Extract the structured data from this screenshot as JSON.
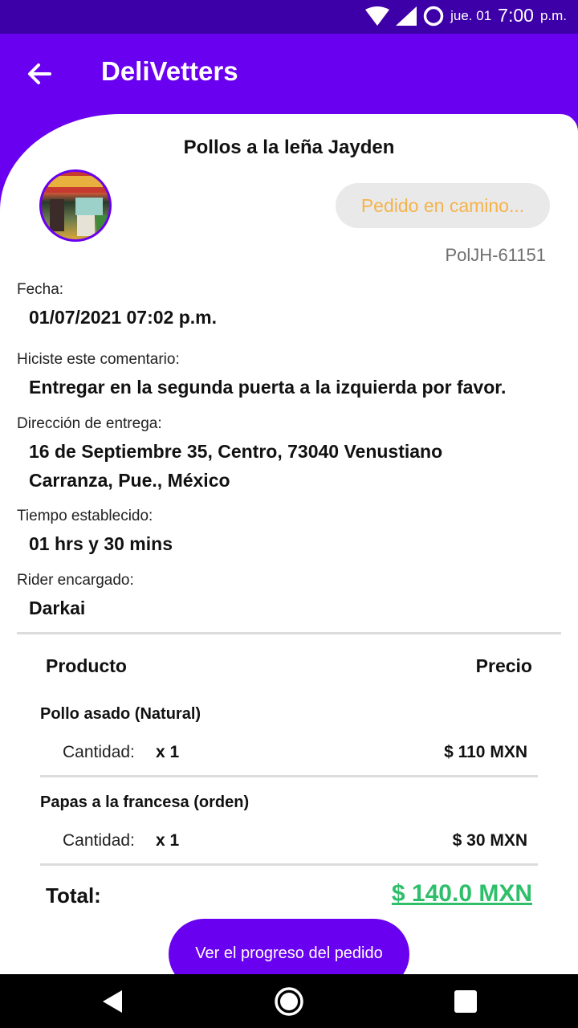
{
  "status_bar": {
    "date": "jue. 01",
    "time": "7:00",
    "time_suffix": "p.m."
  },
  "app_bar": {
    "title": "DeliVetters",
    "back_icon": "arrow-left-icon"
  },
  "order": {
    "store_name": "Pollos a la leña Jayden",
    "status": "Pedido en camino...",
    "code": "PolJH-61151",
    "fields": [
      {
        "label": "Fecha:",
        "value": "01/07/2021 07:02 p.m."
      },
      {
        "label": "Hiciste este comentario:",
        "value": "Entregar en la segunda puerta a la izquierda por favor."
      },
      {
        "label": "Dirección de entrega:",
        "value": "16 de Septiembre 35, Centro, 73040 Venustiano Carranza, Pue., México"
      },
      {
        "label": "Tiempo establecido:",
        "value": "01 hrs y 30 mins"
      },
      {
        "label": "Rider encargado:",
        "value": "Darkai"
      }
    ]
  },
  "table": {
    "header_product": "Producto",
    "header_price": "Precio",
    "items": [
      {
        "name": "Pollo asado (Natural)",
        "qty_label": "Cantidad:",
        "qty": "x 1",
        "price": "$ 110 MXN"
      },
      {
        "name": "Papas a la francesa (orden)",
        "qty_label": "Cantidad:",
        "qty": "x 1",
        "price": "$ 30 MXN"
      }
    ],
    "total_label": "Total:",
    "total_value": "$ 140.0 MXN"
  },
  "actions": {
    "progress_button": "Ver el progreso del pedido"
  },
  "colors": {
    "primary": "#6a00f0",
    "status_bar": "#3d00a8",
    "status_text": "#f5b34a",
    "total": "#2fbf6b"
  }
}
